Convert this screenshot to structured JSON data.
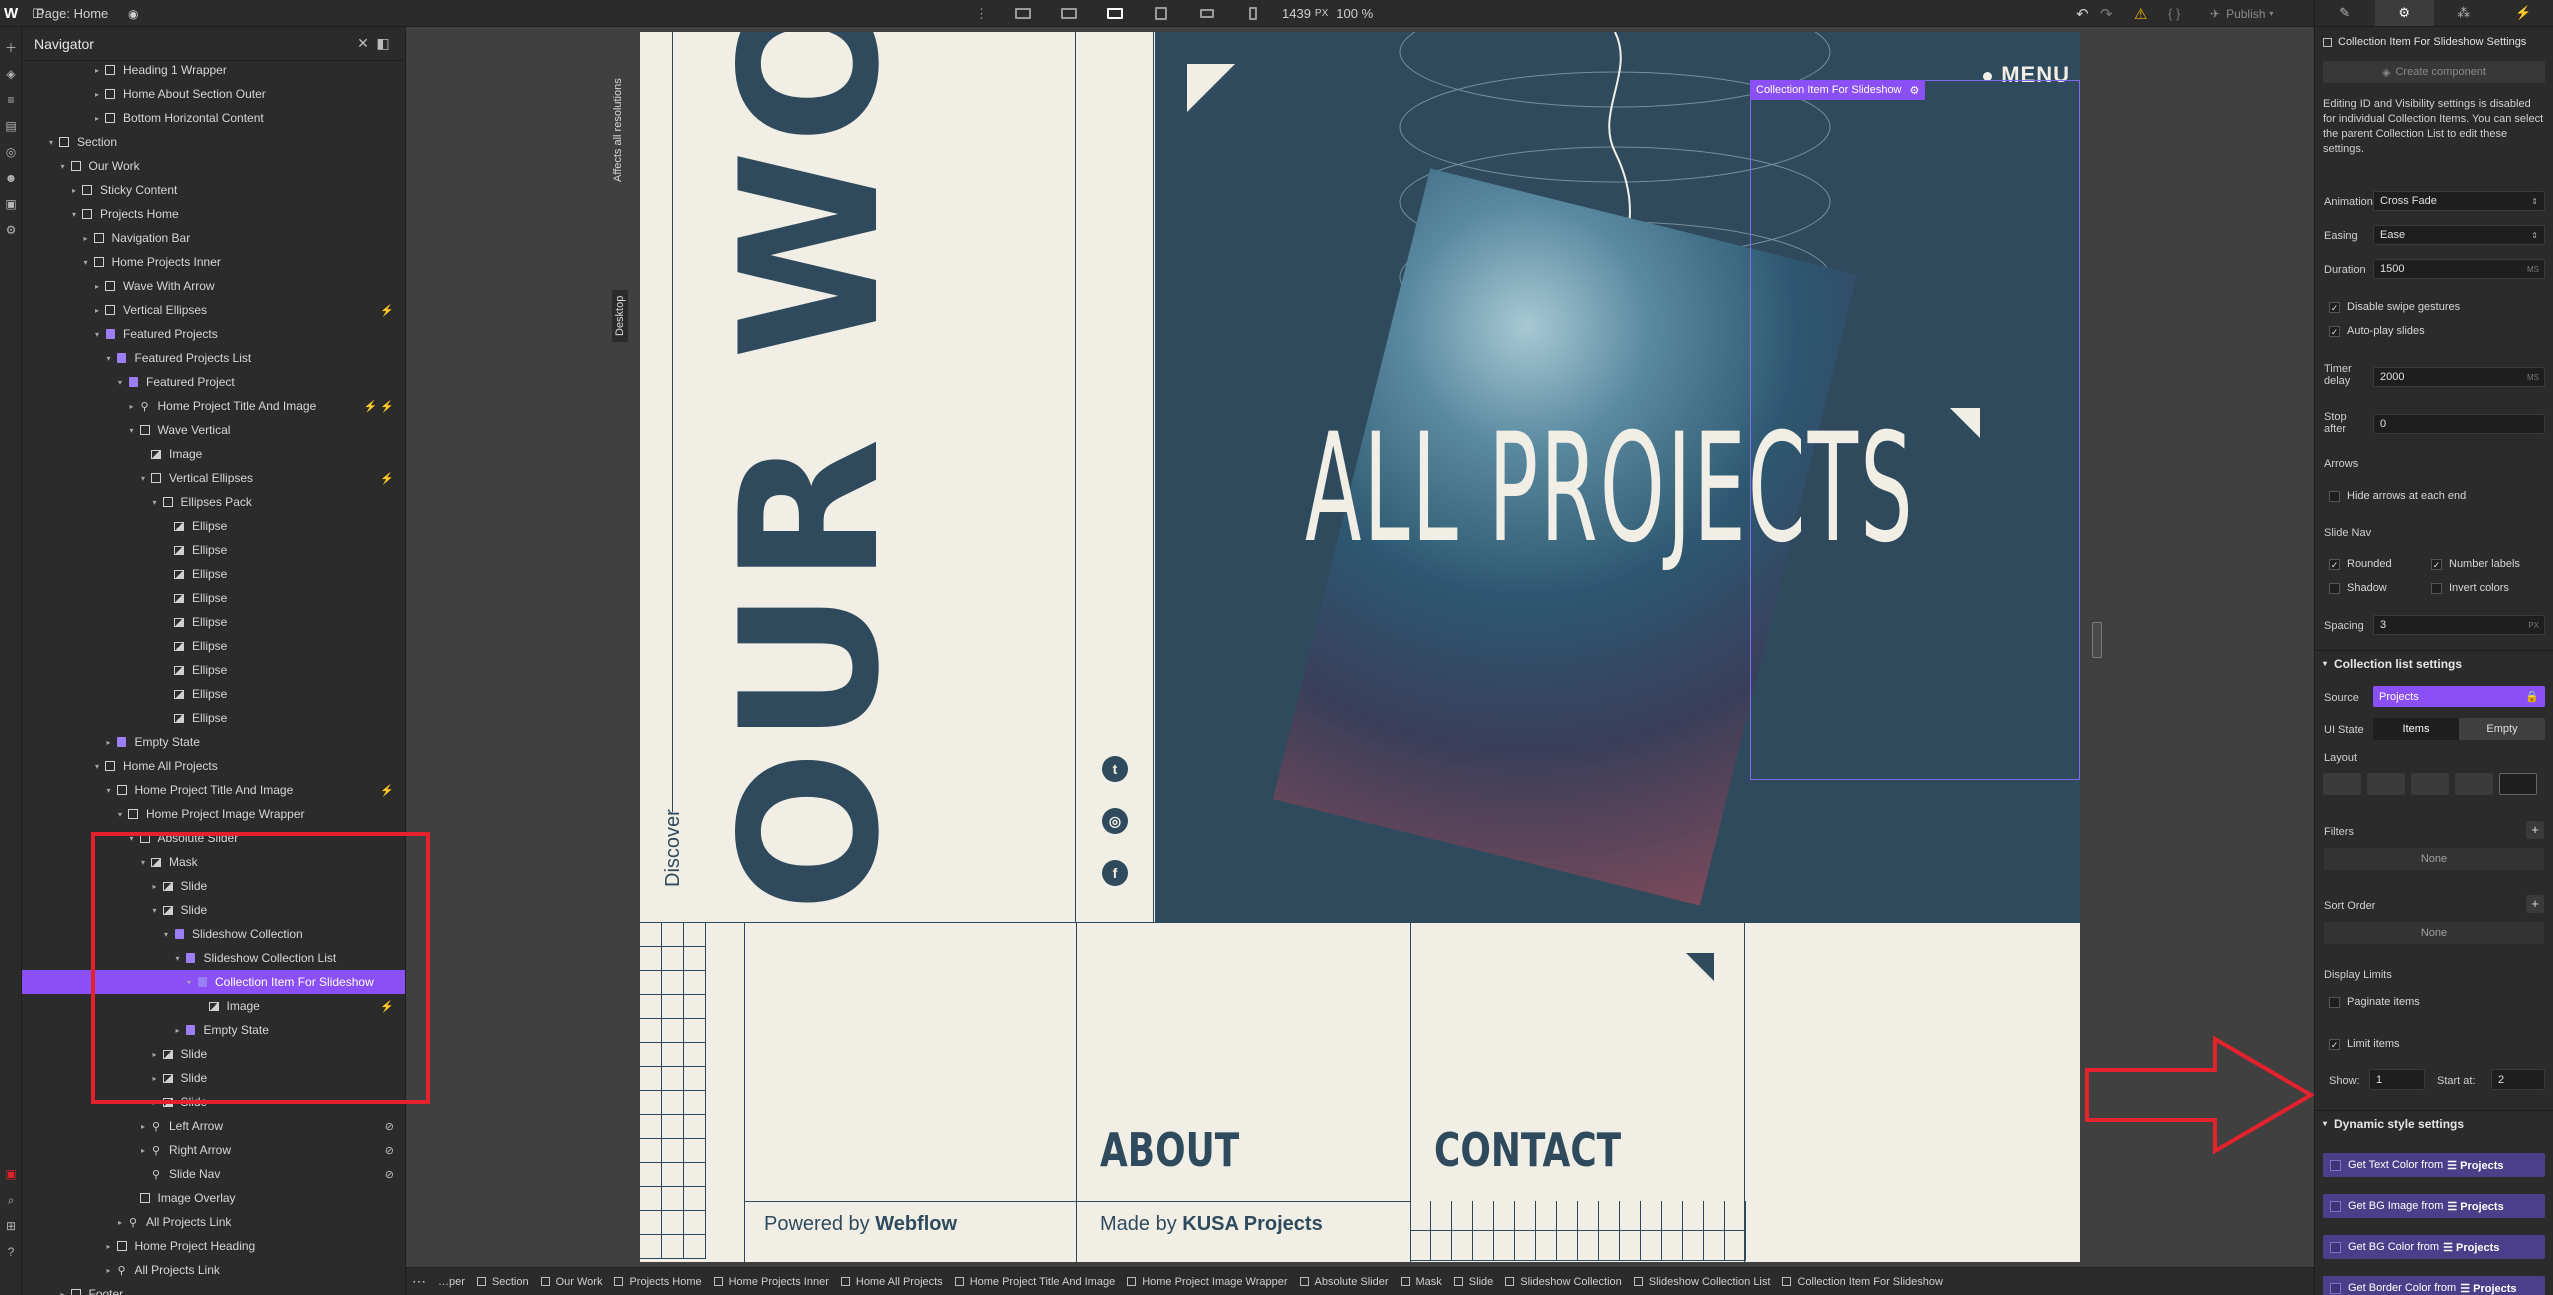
{
  "topbar": {
    "logo": "W",
    "page_label": "Page: Home",
    "width_readout": "1439",
    "width_unit": "PX",
    "zoom": "100 %",
    "publish": "Publish"
  },
  "navigator": {
    "title": "Navigator",
    "rows": [
      {
        "label": "Heading 1 Wrapper",
        "indent": 6,
        "caret": "▸",
        "icon": "box"
      },
      {
        "label": "Home About Section Outer",
        "indent": 6,
        "caret": "▸",
        "icon": "box"
      },
      {
        "label": "Bottom Horizontal Content",
        "indent": 6,
        "caret": "▸",
        "icon": "box"
      },
      {
        "label": "Section",
        "indent": 2,
        "caret": "▾",
        "icon": "box"
      },
      {
        "label": "Our Work",
        "indent": 3,
        "caret": "▾",
        "icon": "box"
      },
      {
        "label": "Sticky Content",
        "indent": 4,
        "caret": "▸",
        "icon": "box"
      },
      {
        "label": "Projects Home",
        "indent": 4,
        "caret": "▾",
        "icon": "box"
      },
      {
        "label": "Navigation Bar",
        "indent": 5,
        "caret": "▸",
        "icon": "box"
      },
      {
        "label": "Home Projects Inner",
        "indent": 5,
        "caret": "▾",
        "icon": "box"
      },
      {
        "label": "Wave With Arrow",
        "indent": 6,
        "caret": "▸",
        "icon": "box"
      },
      {
        "label": "Vertical Ellipses",
        "indent": 6,
        "caret": "▸",
        "icon": "box",
        "badge": "⚡"
      },
      {
        "label": "Featured Projects",
        "indent": 6,
        "caret": "▾",
        "icon": "cms"
      },
      {
        "label": "Featured Projects List",
        "indent": 7,
        "caret": "▾",
        "icon": "cms"
      },
      {
        "label": "Featured Project",
        "indent": 8,
        "caret": "▾",
        "icon": "cms"
      },
      {
        "label": "Home Project Title And Image",
        "indent": 9,
        "caret": "▸",
        "icon": "link",
        "badge": "⚡ ⚡"
      },
      {
        "label": "Wave Vertical",
        "indent": 9,
        "caret": "▾",
        "icon": "box"
      },
      {
        "label": "Image",
        "indent": 10,
        "caret": "",
        "icon": "img"
      },
      {
        "label": "Vertical Ellipses",
        "indent": 10,
        "caret": "▾",
        "icon": "box",
        "badge": "⚡"
      },
      {
        "label": "Ellipses Pack",
        "indent": 11,
        "caret": "▾",
        "icon": "box"
      },
      {
        "label": "Ellipse",
        "indent": 12,
        "caret": "",
        "icon": "img"
      },
      {
        "label": "Ellipse",
        "indent": 12,
        "caret": "",
        "icon": "img"
      },
      {
        "label": "Ellipse",
        "indent": 12,
        "caret": "",
        "icon": "img"
      },
      {
        "label": "Ellipse",
        "indent": 12,
        "caret": "",
        "icon": "img"
      },
      {
        "label": "Ellipse",
        "indent": 12,
        "caret": "",
        "icon": "img"
      },
      {
        "label": "Ellipse",
        "indent": 12,
        "caret": "",
        "icon": "img"
      },
      {
        "label": "Ellipse",
        "indent": 12,
        "caret": "",
        "icon": "img"
      },
      {
        "label": "Ellipse",
        "indent": 12,
        "caret": "",
        "icon": "img"
      },
      {
        "label": "Ellipse",
        "indent": 12,
        "caret": "",
        "icon": "img"
      },
      {
        "label": "Empty State",
        "indent": 7,
        "caret": "▸",
        "icon": "cms"
      },
      {
        "label": "Home All Projects",
        "indent": 6,
        "caret": "▾",
        "icon": "box"
      },
      {
        "label": "Home Project Title And Image",
        "indent": 7,
        "caret": "▾",
        "icon": "box",
        "badge": "⚡"
      },
      {
        "label": "Home Project Image Wrapper",
        "indent": 8,
        "caret": "▾",
        "icon": "box"
      },
      {
        "label": "Absolute Slider",
        "indent": 9,
        "caret": "▾",
        "icon": "box"
      },
      {
        "label": "Mask",
        "indent": 10,
        "caret": "▾",
        "icon": "img"
      },
      {
        "label": "Slide",
        "indent": 11,
        "caret": "▸",
        "icon": "img"
      },
      {
        "label": "Slide",
        "indent": 11,
        "caret": "▾",
        "icon": "img"
      },
      {
        "label": "Slideshow Collection",
        "indent": 12,
        "caret": "▾",
        "icon": "cms"
      },
      {
        "label": "Slideshow Collection List",
        "indent": 13,
        "caret": "▾",
        "icon": "cms"
      },
      {
        "label": "Collection Item For Slideshow",
        "indent": 14,
        "caret": "▾",
        "icon": "cms",
        "selected": true
      },
      {
        "label": "Image",
        "indent": 15,
        "caret": "",
        "icon": "img",
        "badge": "⚡"
      },
      {
        "label": "Empty State",
        "indent": 13,
        "caret": "▸",
        "icon": "cms"
      },
      {
        "label": "Slide",
        "indent": 11,
        "caret": "▸",
        "icon": "img"
      },
      {
        "label": "Slide",
        "indent": 11,
        "caret": "▸",
        "icon": "img"
      },
      {
        "label": "Slide",
        "indent": 11,
        "caret": "▸",
        "icon": "img"
      },
      {
        "label": "Left Arrow",
        "indent": 10,
        "caret": "▸",
        "icon": "link",
        "badge": "⊘"
      },
      {
        "label": "Right Arrow",
        "indent": 10,
        "caret": "▸",
        "icon": "link",
        "badge": "⊘"
      },
      {
        "label": "Slide Nav",
        "indent": 10,
        "caret": "",
        "icon": "link",
        "badge": "⊘"
      },
      {
        "label": "Image Overlay",
        "indent": 9,
        "caret": "",
        "icon": "box"
      },
      {
        "label": "All Projects Link",
        "indent": 8,
        "caret": "▸",
        "icon": "link"
      },
      {
        "label": "Home Project Heading",
        "indent": 7,
        "caret": "▸",
        "icon": "box"
      },
      {
        "label": "All Projects Link",
        "indent": 7,
        "caret": "▸",
        "icon": "link"
      },
      {
        "label": "Footer",
        "indent": 3,
        "caret": "▸",
        "icon": "box"
      }
    ]
  },
  "canvas": {
    "affects_label": "Affects all resolutions",
    "desktop_label": "Desktop",
    "our_work": "OUR WORK",
    "discover": "Discover",
    "hero_title": "ALL PROJECTS",
    "menu": "MENU",
    "selected_label": "Collection Item For Slideshow",
    "about": "ABOUT",
    "contact": "CONTACT",
    "powered_prefix": "Powered by",
    "powered_brand": "Webflow",
    "made_prefix": "Made by",
    "made_brand": "KUSA Projects"
  },
  "breadcrumb": [
    "…per",
    "Section",
    "Our Work",
    "Projects Home",
    "Home Projects Inner",
    "Home All Projects",
    "Home Project Title And Image",
    "Home Project Image Wrapper",
    "Absolute Slider",
    "Mask",
    "Slide",
    "Slideshow Collection",
    "Slideshow Collection List",
    "Collection Item For Slideshow"
  ],
  "settings": {
    "header_title": "Collection Item For Slideshow Settings",
    "create_component": "Create component",
    "info_text": "Editing ID and Visibility settings is disabled for individual Collection Items. You can select the parent Collection List to edit these settings.",
    "animation_label": "Animation",
    "animation_value": "Cross Fade",
    "easing_label": "Easing",
    "easing_value": "Ease",
    "duration_label": "Duration",
    "duration_value": "1500",
    "duration_unit": "MS",
    "disable_swipe": "Disable swipe gestures",
    "autoplay": "Auto-play slides",
    "timer_label": "Timer delay",
    "timer_value": "2000",
    "timer_unit": "MS",
    "stop_label": "Stop after",
    "stop_value": "0",
    "arrows_label": "Arrows",
    "hide_arrows": "Hide arrows at each end",
    "slide_nav_label": "Slide Nav",
    "rounded": "Rounded",
    "number_labels": "Number labels",
    "shadow": "Shadow",
    "invert_colors": "Invert colors",
    "spacing_label": "Spacing",
    "spacing_value": "3",
    "spacing_unit": "PX",
    "collection_section": "Collection list settings",
    "source_label": "Source",
    "source_value": "Projects",
    "ui_state_label": "UI State",
    "ui_items": "Items",
    "ui_empty": "Empty",
    "layout_label": "Layout",
    "filters_label": "Filters",
    "filters_none": "None",
    "sort_label": "Sort Order",
    "sort_none": "None",
    "display_limits": "Display Limits",
    "paginate": "Paginate items",
    "limit": "Limit items",
    "show_label": "Show:",
    "show_value": "1",
    "start_label": "Start at:",
    "start_value": "2",
    "dynamic_section": "Dynamic style settings",
    "dyn_text": "Get Text Color from",
    "dyn_bgimg": "Get BG Image from",
    "dyn_bgcolor": "Get BG Color from",
    "dyn_border": "Get Border Color from",
    "dyn_source": "Projects"
  },
  "colors": {
    "accent": "#8a4ff5",
    "annotation": "#e3222b",
    "site_navy": "#2f4a5c",
    "site_cream": "#f1efe5"
  }
}
